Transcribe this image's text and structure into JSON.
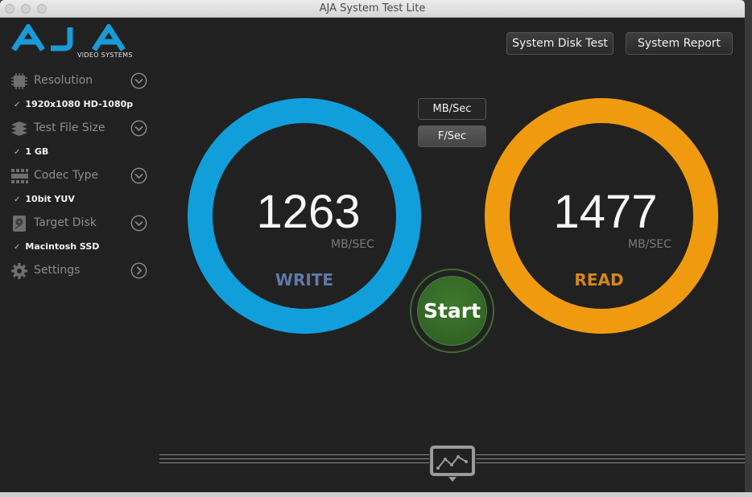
{
  "window": {
    "title": "AJA System Test Lite"
  },
  "logo": {
    "text": "AJA",
    "subtitle": "VIDEO SYSTEMS",
    "color": "#1a9ad6"
  },
  "toolbar": {
    "disk_test_label": "System Disk Test",
    "report_label": "System Report"
  },
  "sidebar": {
    "items": [
      {
        "label": "Resolution",
        "icon": "chip-icon",
        "value": "1920x1080 HD-1080p",
        "chevron": "chevron-down-icon"
      },
      {
        "label": "Test File Size",
        "icon": "stack-icon",
        "value": "1 GB",
        "chevron": "chevron-down-icon"
      },
      {
        "label": "Codec Type",
        "icon": "film-strip-icon",
        "value": "10bit YUV",
        "chevron": "chevron-down-icon"
      },
      {
        "label": "Target Disk",
        "icon": "disk-icon",
        "value": "Macintosh SSD",
        "chevron": "chevron-down-icon"
      },
      {
        "label": "Settings",
        "icon": "gear-icon",
        "chevron": "chevron-right-icon"
      }
    ]
  },
  "units": {
    "mbsec_label": "MB/Sec",
    "fsec_label": "F/Sec"
  },
  "write": {
    "value": "1263",
    "unit": "MB/SEC",
    "label": "WRITE",
    "ring_color": "#119fdc",
    "label_color": "#5e79a8"
  },
  "read": {
    "value": "1477",
    "unit": "MB/SEC",
    "label": "READ",
    "ring_color": "#f09b0f",
    "label_color": "#d4881a"
  },
  "start": {
    "label": "Start"
  },
  "graph": {
    "icon": "graph-icon"
  }
}
